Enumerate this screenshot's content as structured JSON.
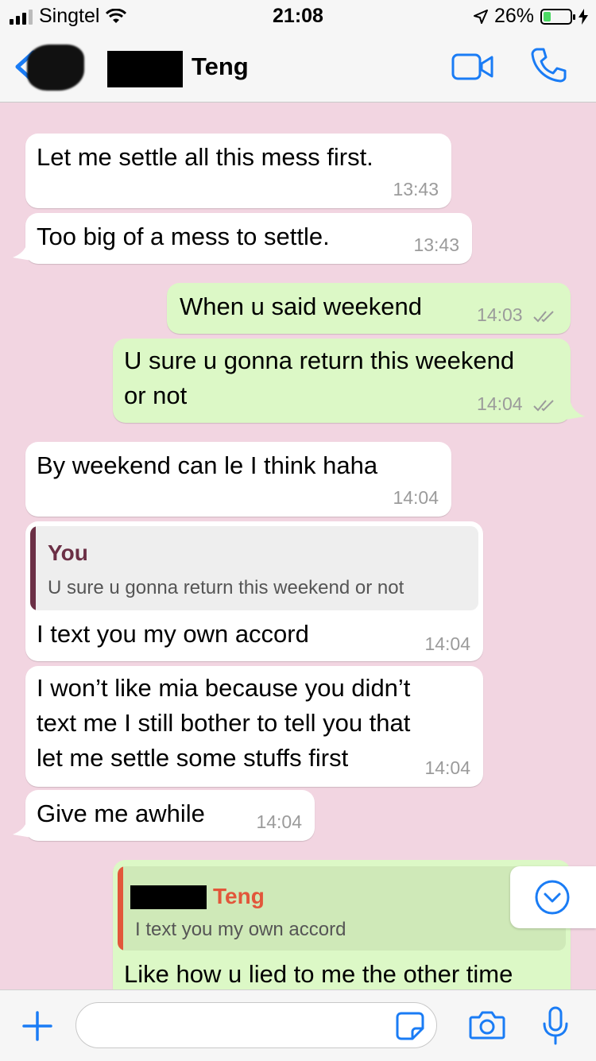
{
  "status_bar": {
    "carrier": "Singtel",
    "time": "21:08",
    "battery_percent": "26%",
    "battery_level": 0.26
  },
  "header": {
    "contact_name": "Teng",
    "back_icon": "chevron-left-icon",
    "video_icon": "video-camera-icon",
    "call_icon": "phone-icon"
  },
  "messages": [
    {
      "direction": "in",
      "text": "Let me settle all this mess first.",
      "time": "13:43"
    },
    {
      "direction": "in",
      "text": "Too big of a mess to settle.",
      "time": "13:43"
    },
    {
      "direction": "out",
      "text": "When u said weekend",
      "time": "14:03"
    },
    {
      "direction": "out",
      "lines": [
        "U sure u gonna return this weekend",
        "or not"
      ],
      "time": "14:04"
    },
    {
      "direction": "in",
      "text": "By weekend can le I think haha",
      "time": "14:04"
    },
    {
      "direction": "in",
      "quote": {
        "author": "You",
        "text": "U sure u gonna return this weekend or not"
      },
      "text": "I text you my own accord",
      "time": "14:04"
    },
    {
      "direction": "in",
      "lines": [
        "I won’t like mia because you didn’t",
        "text me I still bother to tell you that",
        "let me settle some stuffs first"
      ],
      "time": "14:04"
    },
    {
      "direction": "in",
      "text": "Give me awhile",
      "time": "14:04"
    },
    {
      "direction": "out",
      "quote": {
        "author": "Teng",
        "text": "I text you my own accord"
      },
      "text": "Like how u lied to me the other time"
    }
  ],
  "colors": {
    "chat_background": "#f2d5e1",
    "incoming_bubble": "#ffffff",
    "outgoing_bubble": "#dcf8c6",
    "ios_blue": "#1a7cf5",
    "quote_you": "#6b2f45",
    "quote_teng": "#e2563a"
  }
}
